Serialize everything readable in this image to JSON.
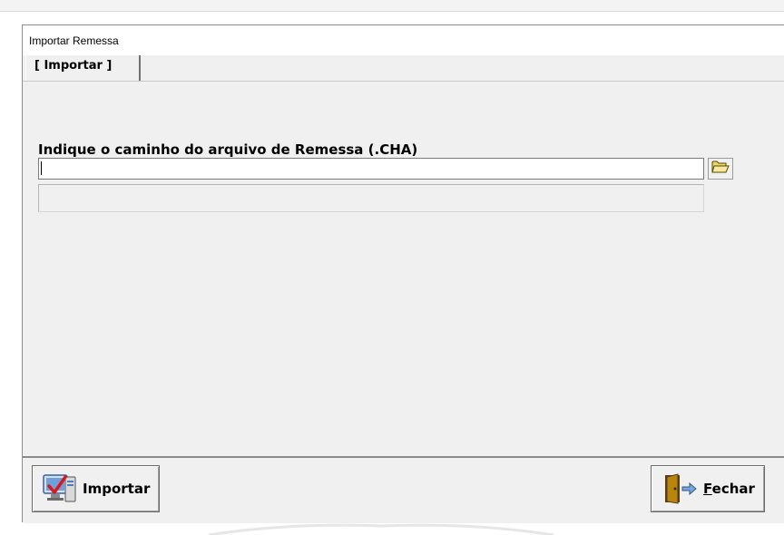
{
  "window": {
    "title": "Importar Remessa"
  },
  "tabs": [
    {
      "label": "[ Importar ]",
      "active": true
    }
  ],
  "form": {
    "prompt_label": "Indique o caminho do arquivo de Remessa (.CHA)",
    "path_value": "",
    "status_text": ""
  },
  "footer": {
    "import_label": "Importar",
    "close_label": "Fechar",
    "close_mnemonic": "F"
  },
  "icons": {
    "browse": "folder-open-icon",
    "import": "computer-check-icon",
    "close": "exit-door-icon"
  },
  "colors": {
    "background": "#f0f0f0",
    "titlebar": "#ffffff",
    "border_dark": "#6a6a6a"
  }
}
